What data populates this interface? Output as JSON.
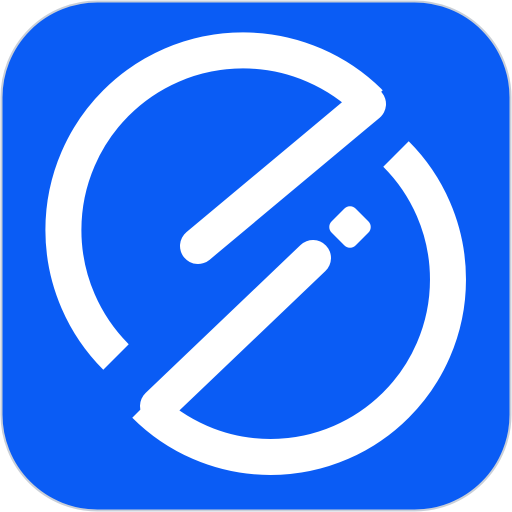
{
  "icon": {
    "name": "app-logo-icon",
    "background_color": "#0A5CF5",
    "border_color": "#C9CFD8",
    "mark_color": "#FFFFFF"
  }
}
